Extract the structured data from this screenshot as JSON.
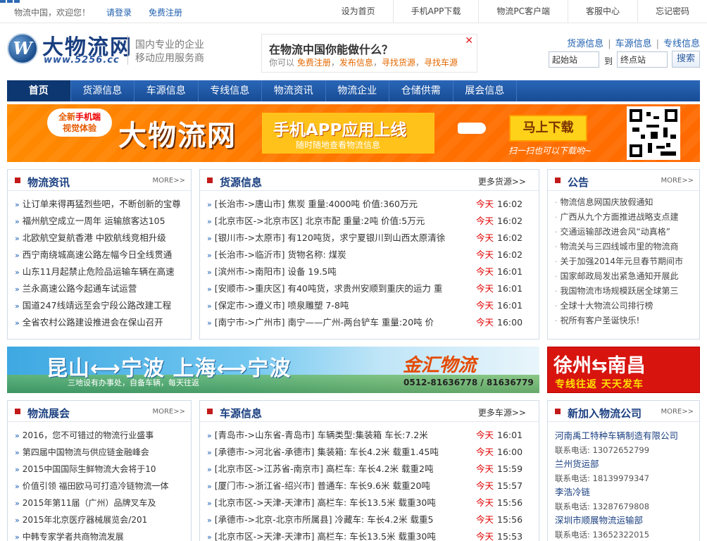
{
  "topbar": {
    "greeting": "物流中国，欢迎您！",
    "login": "请登录",
    "register": "免费注册",
    "links": [
      "设为首页",
      "手机APP下载",
      "物流PC客户端",
      "客服中心",
      "忘记密码"
    ]
  },
  "header": {
    "logo_text": "大物流网",
    "logo_url": "www.5256.cc",
    "slogan_line1": "国内专业的企业",
    "slogan_line2": "移动应用服务商",
    "question": "在物流中国你能做什么？",
    "prompt_prefix": "你可以",
    "prompt_links": [
      "免费注册",
      "发布信息",
      "寻找货源",
      "寻找车源"
    ],
    "quick_links": [
      "货源信息",
      "车源信息",
      "专线信息"
    ],
    "start_placeholder": "起始站",
    "to_label": "到",
    "end_placeholder": "终点站",
    "search_label": "搜索"
  },
  "nav": [
    "首页",
    "货源信息",
    "车源信息",
    "专线信息",
    "物流资讯",
    "物流企业",
    "仓储供需",
    "展会信息"
  ],
  "banner": {
    "bubble_line1_a": "全新",
    "bubble_line1_b": "手机端",
    "bubble_line2": "视觉体验",
    "logo": "大物流网",
    "plate_title": "手机APP应用上线",
    "plate_sub": "随时随地查看物流信息",
    "download": "马上下载",
    "scan": "扫一扫也可以下载哟~"
  },
  "news": {
    "title": "物流资讯",
    "more": "MORE>>",
    "items": [
      "让订单来得再猛烈些吧，不断创新的宝尊",
      "福州航空成立一周年 运输旅客达105",
      "北欧航空复航香港 中欧航线竞相升级",
      "西宁南绕城高速公路左幅今日全线贯通",
      "山东11月起禁止危险品运输车辆在高速",
      "兰永高速公路今起通车试运营",
      "国道247线靖远至会宁段公路改建工程",
      "全省农村公路建设推进会在保山召开"
    ]
  },
  "cargo": {
    "title": "货源信息",
    "more": "更多货源>>",
    "today": "今天",
    "items": [
      {
        "text": "[长治市->唐山市]  焦炭 重量:4000吨 价值:360万元",
        "time": "16:02"
      },
      {
        "text": "[北京市区->北京市区]  北京市配 重量:2吨 价值:5万元",
        "time": "16:02"
      },
      {
        "text": "[银川市->太原市]  有120吨货，求宁夏银川到山西太原清徐",
        "time": "16:02"
      },
      {
        "text": "[长治市->临沂市]  货物名称: 煤炭",
        "time": "16:02"
      },
      {
        "text": "[滨州市->南阳市]  设备 19.5吨",
        "time": "16:01"
      },
      {
        "text": "[安顺市->重庆区]  有40吨货，求贵州安顺到重庆的运力 重",
        "time": "16:01"
      },
      {
        "text": "[保定市->遵义市]  喷泉雕塑 7-8吨",
        "time": "16:01"
      },
      {
        "text": "[南宁市->广州市]  南宁——广州-两台铲车 重量:20吨 价",
        "time": "16:00"
      }
    ]
  },
  "notice": {
    "title": "公告",
    "more": "MORE>>",
    "items": [
      "物流信息网国庆放假通知",
      "广西从九个方面推进战略支点建",
      "交通运输部改进会风“动真格”",
      "物流关与三四线城市里的物流商",
      "关于加强2014年元旦春节期间市",
      "国家邮政局发出紧急通知开展此",
      "我国物流市场规模跃居全球第三",
      "全球十大物流公司排行榜",
      "祝所有客户圣诞快乐!"
    ]
  },
  "ad_mid": {
    "routes": "昆山⟷宁波 上海⟷宁波",
    "sub": "三地设有办事处，自备车辆，每天往返",
    "brand": "金汇物流",
    "phone": "0512-81636778 / 81636779",
    "right_title": "徐州⇆南昌",
    "right_sub": "专线往返 天天发车"
  },
  "expo": {
    "title": "物流展会",
    "more": "MORE>>",
    "items": [
      "2016，您不可错过的物流行业盛事",
      "第四届中国物流与供应链金融峰会",
      "2015中国国际生鲜物流大会将于10",
      "价值引领 福田欧马可打造冷链物流一体",
      "2015年第11届（广州）品牌叉车及",
      "2015年北京医疗器械展览会/201",
      "中韩专家学者共商物流发展"
    ]
  },
  "trucks": {
    "title": "车源信息",
    "more": "更多车源>>",
    "today": "今天",
    "items": [
      {
        "text": "[青岛市->山东省-青岛市]  车辆类型:集装箱 车长:7.2米",
        "time": "16:01"
      },
      {
        "text": "[承德市->河北省-承德市]  集装箱: 车长4.2米 载重1.45吨",
        "time": "16:00"
      },
      {
        "text": "[北京市区->江苏省-南京市]  高栏车: 车长4.2米 载重2吨",
        "time": "15:59"
      },
      {
        "text": "[厦门市->浙江省-绍兴市]  普通车: 车长9.6米 载重20吨",
        "time": "15:57"
      },
      {
        "text": "[北京市区->天津-天津市]  高栏车: 车长13.5米 载重30吨",
        "time": "15:56"
      },
      {
        "text": "[承德市->北京-北京市所属县]  冷藏车: 车长4.2米 载重5",
        "time": "15:56"
      },
      {
        "text": "[北京市区->天津-天津市]  高栏车: 车长13.5米 载重30吨",
        "time": "15:53"
      }
    ]
  },
  "companies": {
    "title": "新加入物流公司",
    "more": "MORE>>",
    "phone_label": "联系电话:",
    "items": [
      {
        "name": "河南禹工特种车辆制造有限公司",
        "phone": "13072652799"
      },
      {
        "name": "兰州货运部",
        "phone": "18139979347"
      },
      {
        "name": "李浩冷链",
        "phone": "13287679808"
      },
      {
        "name": "深圳市顺展物流运输部",
        "phone": "13652322015"
      }
    ]
  },
  "colors": {
    "nav_blue": "#1f5aa8",
    "title_blue": "#1a3f80",
    "link_blue": "#2060b0",
    "today_red": "#e00000",
    "banner_orange": "#ff7a00"
  }
}
